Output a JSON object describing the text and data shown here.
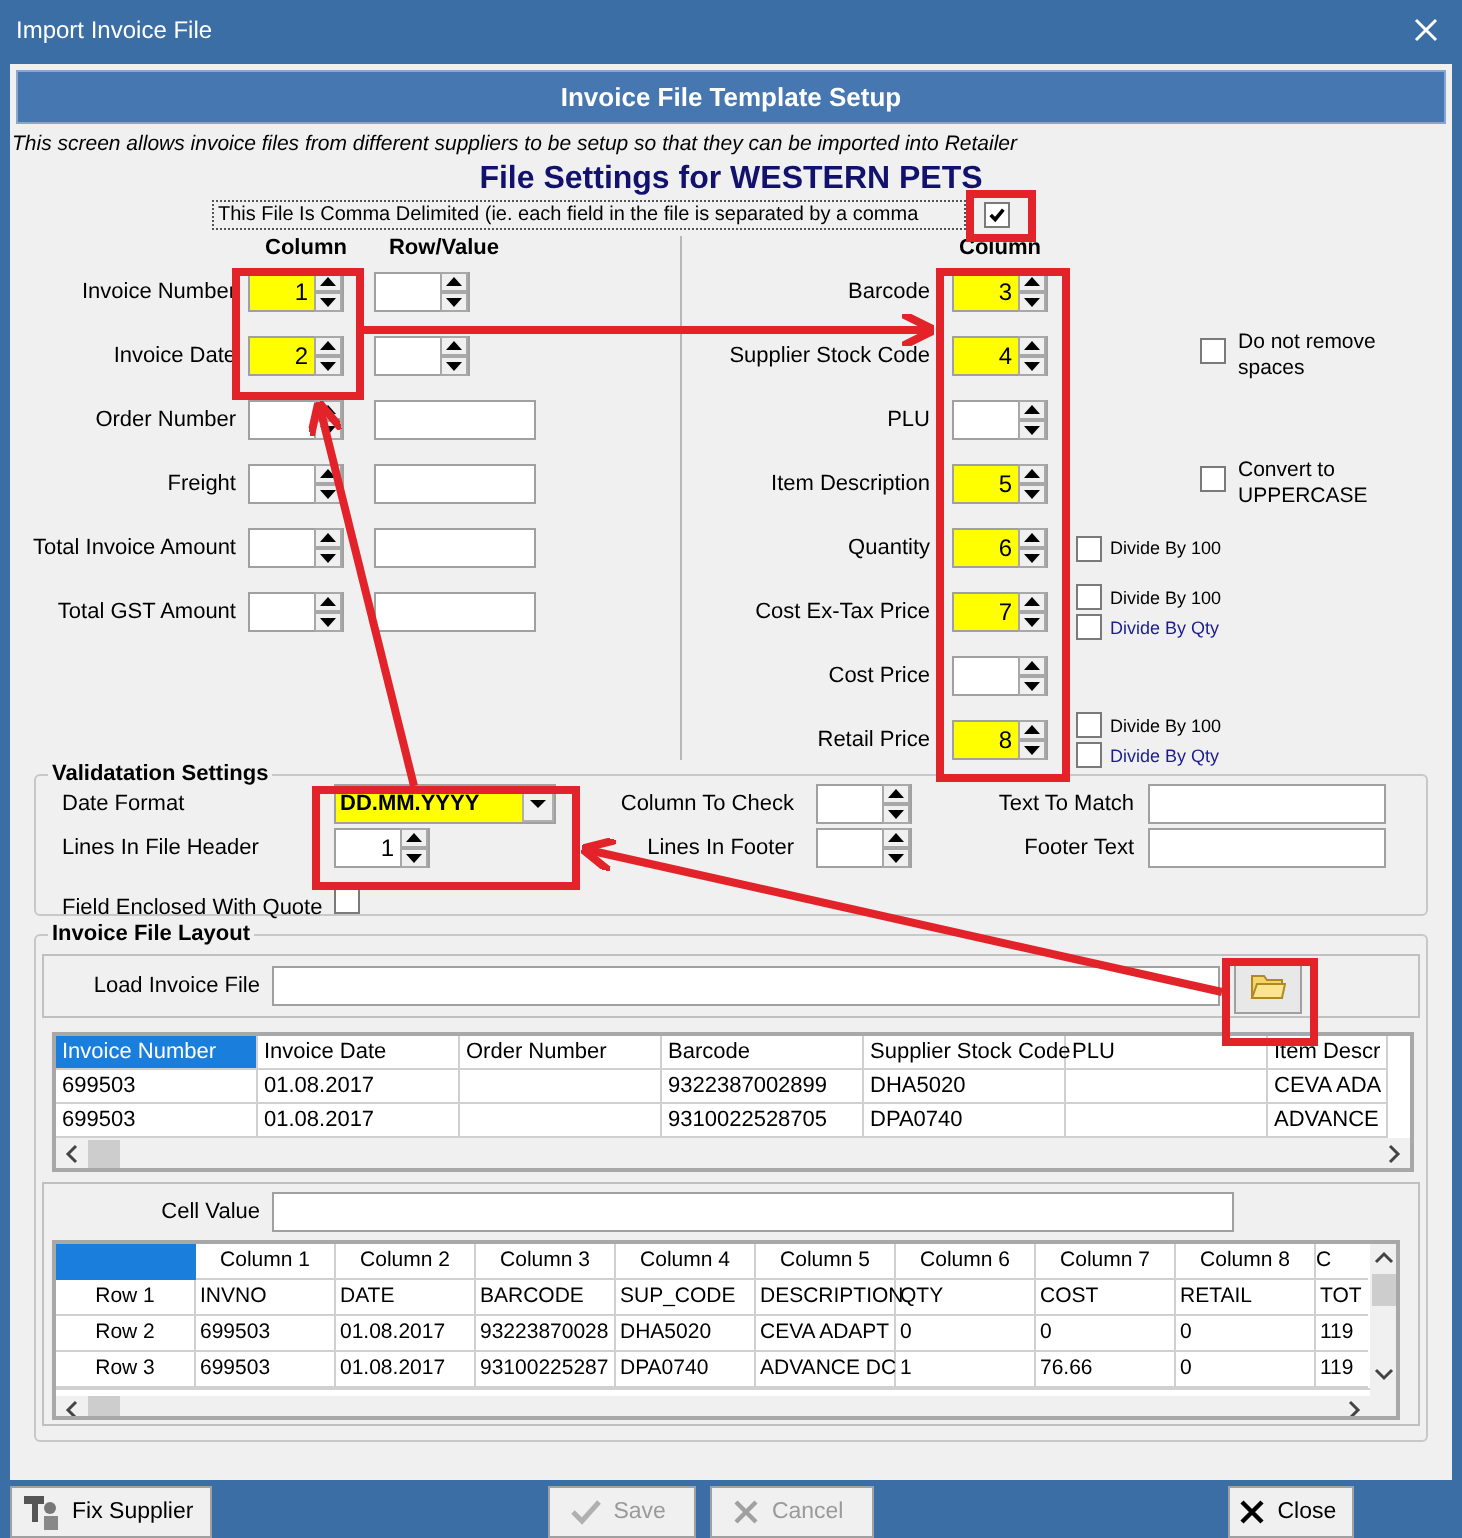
{
  "window": {
    "title": "Import Invoice File"
  },
  "header": {
    "title": "Invoice File Template Setup",
    "description": "This screen allows invoice files from different suppliers to be setup so that they can be imported into Retailer"
  },
  "file_settings": {
    "title": "File Settings for WESTERN PETS",
    "comma_delimited": {
      "label": "This File Is Comma Delimited (ie. each field in the file is separated by a comma",
      "checked": true
    },
    "left_headers": [
      "Column",
      "Row/Value"
    ],
    "left_fields": [
      {
        "label": "Invoice Number",
        "column": "1",
        "highlighted": true,
        "row_value": {
          "kind": "spinner"
        }
      },
      {
        "label": "Invoice Date",
        "column": "2",
        "highlighted": true,
        "row_value": {
          "kind": "spinner"
        }
      },
      {
        "label": "Order Number",
        "highlighted": false,
        "row_value": {
          "kind": "text"
        }
      },
      {
        "label": "Freight",
        "highlighted": false,
        "row_value": {
          "kind": "text"
        }
      },
      {
        "label": "Total Invoice Amount",
        "highlighted": false,
        "row_value": {
          "kind": "text"
        }
      },
      {
        "label": "Total GST Amount",
        "highlighted": false,
        "row_value": {
          "kind": "text"
        }
      }
    ],
    "right_header": "Column",
    "right_fields": [
      {
        "label": "Barcode",
        "column": "3",
        "highlighted": true
      },
      {
        "label": "Supplier Stock Code",
        "column": "4",
        "highlighted": true,
        "side_option": {
          "label": "Do not remove spaces",
          "checked": false
        }
      },
      {
        "label": "PLU",
        "highlighted": false
      },
      {
        "label": "Item Description",
        "column": "5",
        "highlighted": true,
        "side_option": {
          "label": "Convert to UPPERCASE",
          "checked": false
        }
      },
      {
        "label": "Quantity",
        "column": "6",
        "highlighted": true,
        "options": [
          {
            "label": "Divide By 100",
            "kind": "plain",
            "checked": false
          }
        ]
      },
      {
        "label": "Cost Ex-Tax Price",
        "column": "7",
        "highlighted": true,
        "options": [
          {
            "label": "Divide By 100",
            "kind": "plain",
            "checked": false
          },
          {
            "label": "Divide By Qty",
            "kind": "accent",
            "checked": false
          }
        ]
      },
      {
        "label": "Cost Price",
        "highlighted": false
      },
      {
        "label": "Retail Price",
        "column": "8",
        "highlighted": true,
        "options": [
          {
            "label": "Divide By 100",
            "kind": "plain",
            "checked": false
          },
          {
            "label": "Divide By Qty",
            "kind": "accent",
            "checked": false
          }
        ]
      }
    ]
  },
  "validation": {
    "title": "Validatation Settings",
    "date_format": {
      "label": "Date Format",
      "value": "DD.MM.YYYY",
      "highlighted": true
    },
    "lines_in_header": {
      "label": "Lines In File Header",
      "value": "1"
    },
    "field_enclosed_with_quote": {
      "label": "Field Enclosed With Quote",
      "checked": false
    },
    "column_to_check": {
      "label": "Column To Check"
    },
    "lines_in_footer": {
      "label": "Lines In Footer"
    },
    "text_to_match": {
      "label": "Text To Match"
    },
    "footer_text": {
      "label": "Footer Text"
    }
  },
  "layout": {
    "title": "Invoice File Layout",
    "load_label": "Load Invoice File",
    "file_grid": {
      "columns": [
        {
          "label": "Invoice Number",
          "selected": true
        },
        {
          "label": "Invoice Date",
          "selected": false
        },
        {
          "label": "Order Number",
          "selected": false
        },
        {
          "label": "Barcode",
          "selected": false
        },
        {
          "label": "Supplier Stock Code",
          "selected": false
        },
        {
          "label": "PLU",
          "selected": false
        },
        {
          "label": "Item Descr",
          "selected": false
        }
      ],
      "rows": [
        [
          "699503",
          "01.08.2017",
          null,
          "9322387002899",
          "DHA5020",
          null,
          "CEVA ADA"
        ],
        [
          "699503",
          "01.08.2017",
          null,
          "9310022528705",
          "DPA0740",
          null,
          "ADVANCE"
        ]
      ]
    },
    "cell_value_label": "Cell Value",
    "raw_grid": {
      "rows": [
        {
          "kind": "header",
          "cells": [
            "Column 1",
            "Column 2",
            "Column 3",
            "Column 4",
            "Column 5",
            "Column 6",
            "Column 7",
            "Column 8",
            "C"
          ]
        },
        {
          "kind": "data",
          "header": "Row 1",
          "cells": [
            "INVNO",
            "DATE",
            "BARCODE",
            "SUP_CODE",
            "DESCRIPTION",
            "QTY",
            "COST",
            "RETAIL",
            "TOT"
          ]
        },
        {
          "kind": "data",
          "header": "Row 2",
          "cells": [
            "699503",
            "01.08.2017",
            "93223870028",
            "DHA5020",
            "CEVA ADAPT",
            "0",
            "0",
            "0",
            "119"
          ]
        },
        {
          "kind": "data",
          "header": "Row 3",
          "cells": [
            "699503",
            "01.08.2017",
            "93100225287",
            "DPA0740",
            "ADVANCE DC",
            "1",
            "76.66",
            "0",
            "119"
          ]
        }
      ]
    }
  },
  "buttons": [
    {
      "label": "Fix Supplier",
      "kind": "fix",
      "disabled": false
    },
    {
      "label": "Save",
      "kind": "save",
      "disabled": true
    },
    {
      "label": "Cancel",
      "kind": "cancel",
      "disabled": true
    },
    {
      "label": "Close",
      "kind": "close",
      "disabled": false
    }
  ]
}
